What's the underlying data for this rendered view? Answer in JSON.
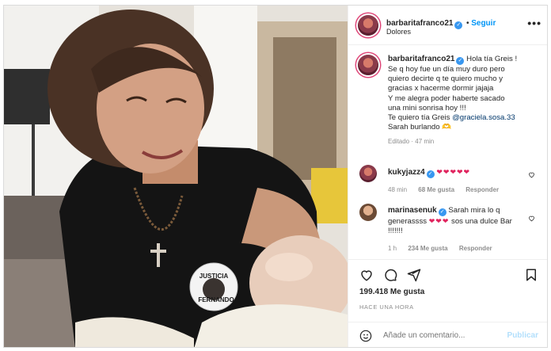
{
  "post": {
    "author": "barbaritafranco21",
    "follow_label": "Seguir",
    "location": "Dolores",
    "more_icon": "more-horizontal-icon",
    "photo_badge": {
      "line1": "JUSTICIA",
      "line2": "FERNANDO"
    }
  },
  "caption": {
    "author": "barbaritafranco21",
    "lines": [
      "Hola tía Greis !",
      "Se q hoy fue un día muy duro pero",
      "quiero decirte q te quiero mucho y",
      "gracias x hacerme dormir jajaja",
      "Y me alegra poder haberte sacado",
      "una mini sonrisa hoy !!!"
    ],
    "line_mention_prefix": "Te quiero tía Greis ",
    "mention": "@graciela.sosa.33",
    "last_line": "Sarah burlando 🫶",
    "meta": "Editado · 47 min"
  },
  "comments": [
    {
      "user": "kukyjazz4",
      "text_hearts": "❤❤❤❤❤",
      "age": "48 min",
      "likes": "68 Me gusta",
      "reply": "Responder"
    },
    {
      "user": "marinasenuk",
      "text": "Sarah mira lo q generassss",
      "text_hearts": "❤❤❤",
      "text_tail": "sos una dulce Bar !!!!!!!",
      "age": "1 h",
      "likes": "234 Me gusta",
      "reply": "Responder"
    }
  ],
  "stats": {
    "likes": "199.418 Me gusta",
    "time": "HACE UNA HORA"
  },
  "composer": {
    "placeholder": "Añade un comentario...",
    "publish": "Publicar"
  },
  "colors": {
    "accent": "#0095f6",
    "verified": "#3897f0",
    "heart": "#e0245e",
    "muted": "#8e8e8e"
  }
}
